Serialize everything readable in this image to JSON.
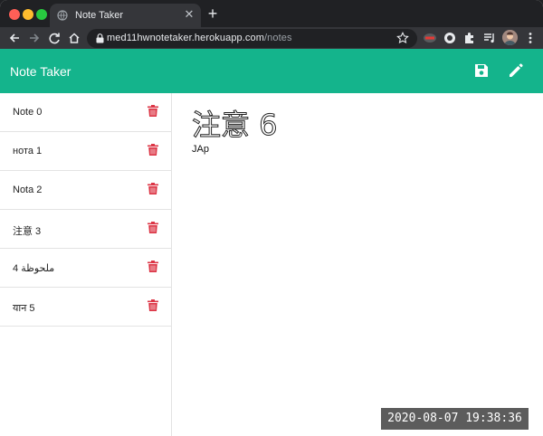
{
  "browser": {
    "tab": {
      "title": "Note Taker"
    },
    "address_bar": {
      "host": "med11hwnotetaker.herokuapp.com",
      "path": "/notes"
    }
  },
  "app": {
    "title": "Note Taker",
    "colors": {
      "header": "#14b48c",
      "trash": "#dc3545"
    },
    "icons": {
      "save": "save-icon",
      "new": "pencil-icon",
      "delete": "trash-icon"
    }
  },
  "notes": [
    {
      "title": "Note 0"
    },
    {
      "title": "нота 1"
    },
    {
      "title": "Nota 2"
    },
    {
      "title": "注意 3"
    },
    {
      "title": "4 ملحوظة"
    },
    {
      "title": "यान 5"
    }
  ],
  "active_note": {
    "title": "注意 6",
    "text": "JAp"
  },
  "overlay": {
    "timestamp": "2020-08-07 19:38:36"
  }
}
